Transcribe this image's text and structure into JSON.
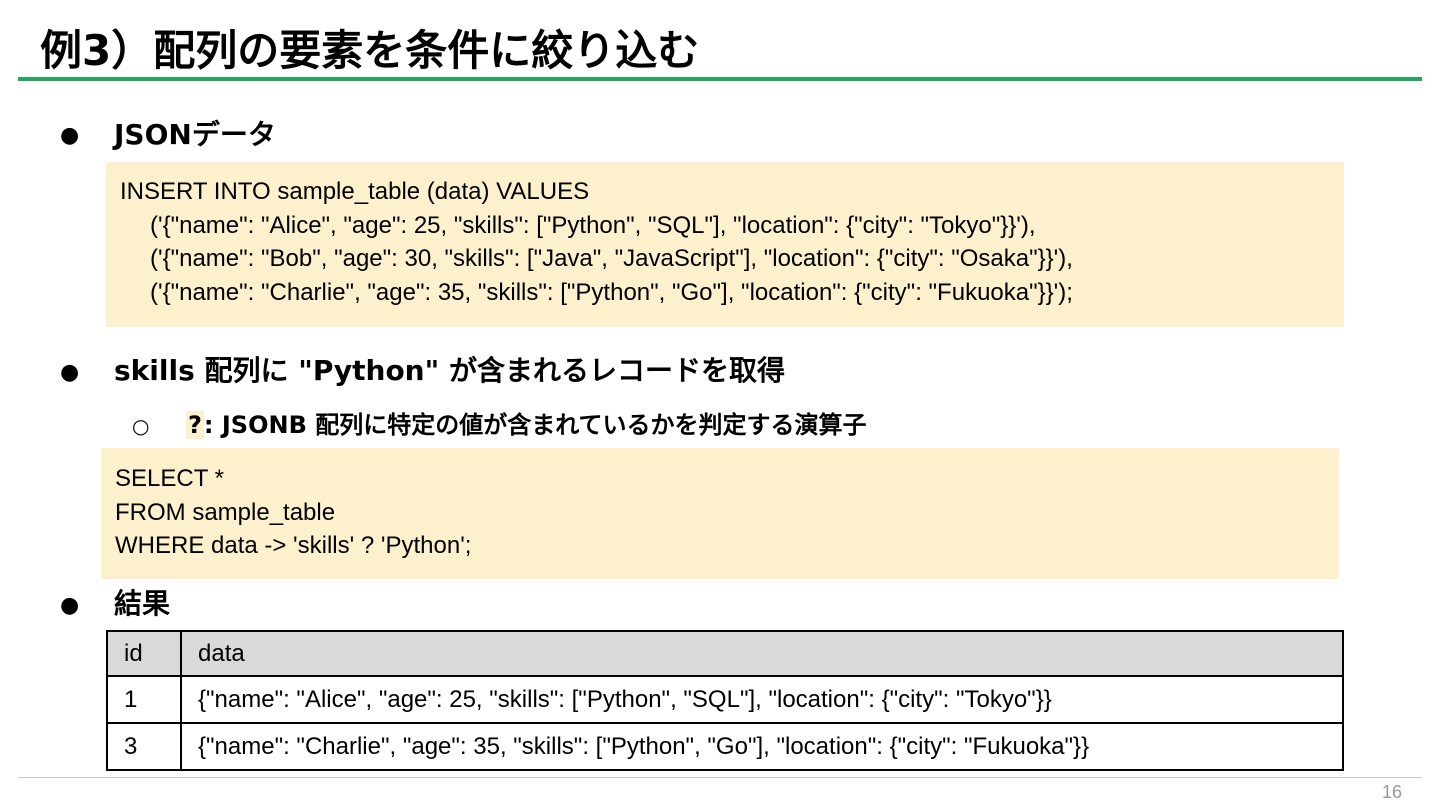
{
  "slide": {
    "title": "例3）配列の要素を条件に絞り込む",
    "page_number": "16",
    "bullet_symbol": "●",
    "sub_bullet_symbol": "○",
    "accent_color": "#22a65a",
    "code_bg_color": "#fdf0cc"
  },
  "sections": {
    "json_data": {
      "heading": "JSONデータ",
      "code": [
        "INSERT INTO sample_table (data) VALUES",
        "('{\"name\": \"Alice\", \"age\": 25, \"skills\": [\"Python\", \"SQL\"], \"location\": {\"city\": \"Tokyo\"}}'),",
        "('{\"name\": \"Bob\", \"age\": 30, \"skills\": [\"Java\", \"JavaScript\"], \"location\": {\"city\": \"Osaka\"}}'),",
        "('{\"name\": \"Charlie\", \"age\": 35, \"skills\": [\"Python\", \"Go\"], \"location\": {\"city\": \"Fukuoka\"}}');"
      ]
    },
    "query": {
      "heading": "skills 配列に \"Python\" が含まれるレコードを取得",
      "operator": "?",
      "operator_desc": ":  JSONB 配列に特定の値が含まれているかを判定する演算子",
      "code": [
        "SELECT *",
        "FROM sample_table",
        "WHERE data -> 'skills' ? 'Python';"
      ]
    },
    "result": {
      "heading": "結果",
      "columns": [
        "id",
        "data"
      ],
      "rows": [
        [
          "1",
          "{\"name\": \"Alice\", \"age\": 25, \"skills\": [\"Python\", \"SQL\"], \"location\": {\"city\": \"Tokyo\"}}"
        ],
        [
          "3",
          "{\"name\": \"Charlie\", \"age\": 35, \"skills\": [\"Python\", \"Go\"], \"location\": {\"city\": \"Fukuoka\"}}"
        ]
      ]
    }
  }
}
